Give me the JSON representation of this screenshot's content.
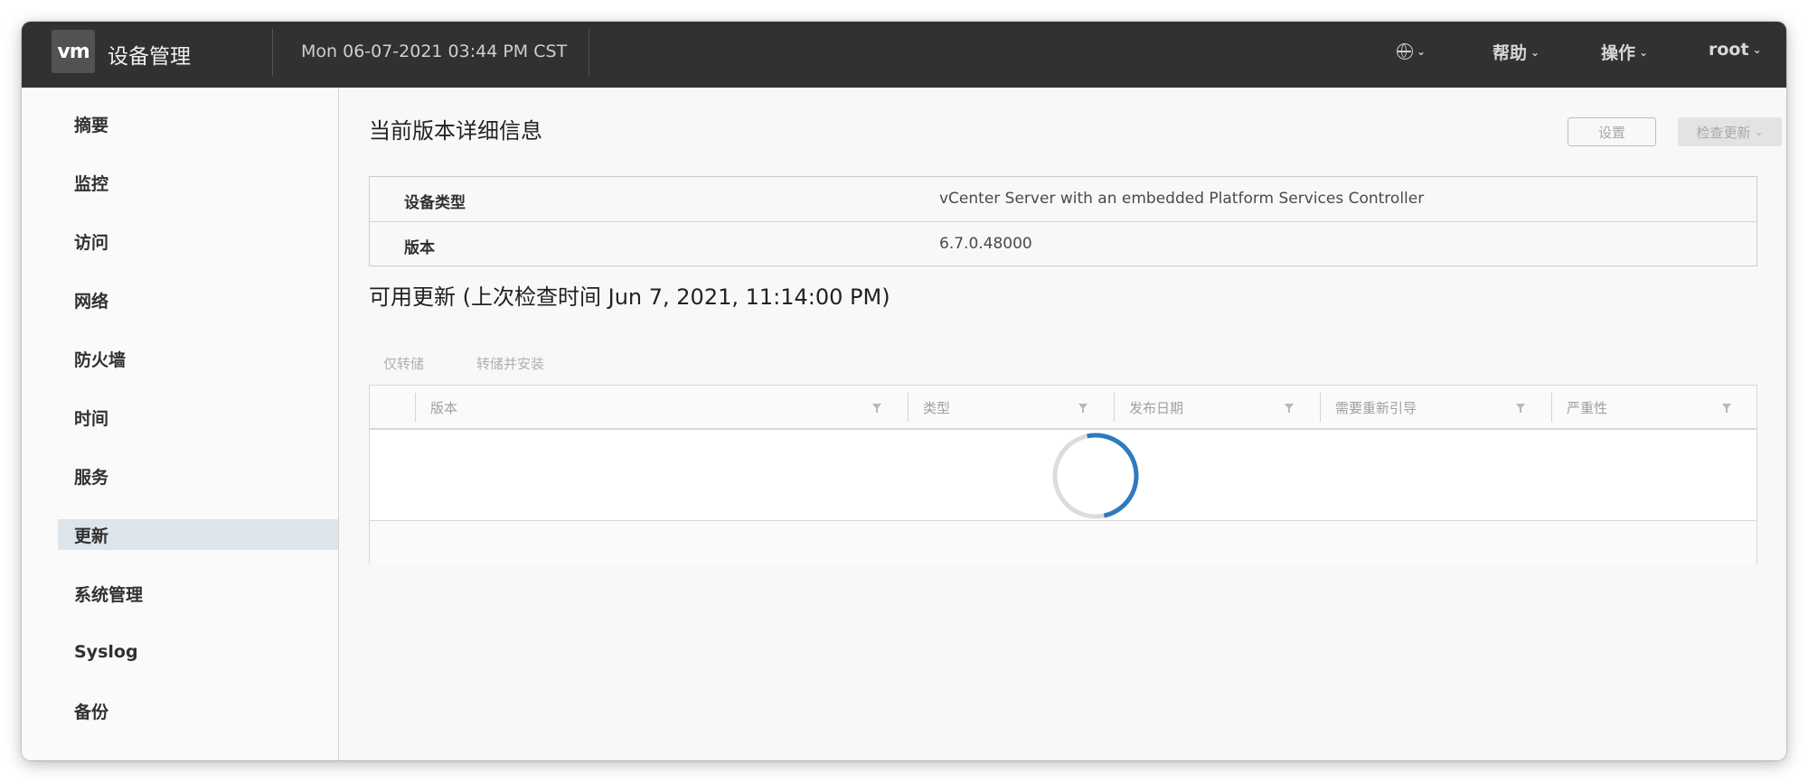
{
  "header": {
    "logo_text": "vm",
    "app_title": "设备管理",
    "datetime": "Mon 06-07-2021 03:44 PM CST",
    "menu": {
      "language_icon": "globe-icon",
      "help": "帮助",
      "actions": "操作",
      "user": "root"
    }
  },
  "sidebar": {
    "items": [
      {
        "label": "摘要"
      },
      {
        "label": "监控"
      },
      {
        "label": "访问"
      },
      {
        "label": "网络"
      },
      {
        "label": "防火墙"
      },
      {
        "label": "时间"
      },
      {
        "label": "服务"
      },
      {
        "label": "更新",
        "active": true
      },
      {
        "label": "系统管理"
      },
      {
        "label": "Syslog"
      },
      {
        "label": "备份"
      }
    ]
  },
  "current_version": {
    "title": "当前版本详细信息",
    "settings_button": "设置",
    "check_updates_button": "检查更新",
    "rows": [
      {
        "label": "设备类型",
        "value": "vCenter Server with an embedded Platform Services Controller"
      },
      {
        "label": "版本",
        "value": "6.7.0.48000"
      }
    ]
  },
  "available_updates": {
    "title": "可用更新 (上次检查时间 Jun 7, 2021, 11:14:00 PM)",
    "actions": {
      "stage_only": "仅转储",
      "stage_and_install": "转储并安装"
    },
    "columns": [
      {
        "label": "版本"
      },
      {
        "label": "类型"
      },
      {
        "label": "发布日期"
      },
      {
        "label": "需要重新引导"
      },
      {
        "label": "严重性"
      }
    ],
    "loading": true
  },
  "colors": {
    "topbar": "#313131",
    "accent": "#2f7abf",
    "active_nav": "#dde5ec"
  }
}
